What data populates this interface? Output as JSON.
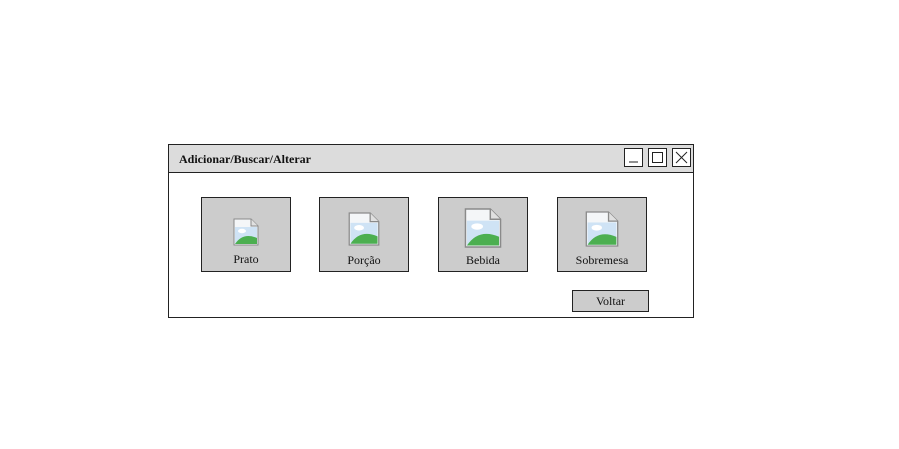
{
  "window": {
    "title": "Adicionar/Buscar/Alterar",
    "controls": {
      "minimize_icon": "minimize-icon",
      "maximize_icon": "maximize-icon",
      "close_icon": "close-icon"
    }
  },
  "tiles": [
    {
      "label": "Prato",
      "icon": "image-placeholder-icon"
    },
    {
      "label": "Porção",
      "icon": "image-placeholder-icon"
    },
    {
      "label": "Bebida",
      "icon": "image-placeholder-icon"
    },
    {
      "label": "Sobremesa",
      "icon": "image-placeholder-icon"
    }
  ],
  "footer": {
    "back_label": "Voltar"
  },
  "colors": {
    "titlebar": "#dcdcdc",
    "tile_bg": "#cccccc",
    "border": "#222222"
  }
}
